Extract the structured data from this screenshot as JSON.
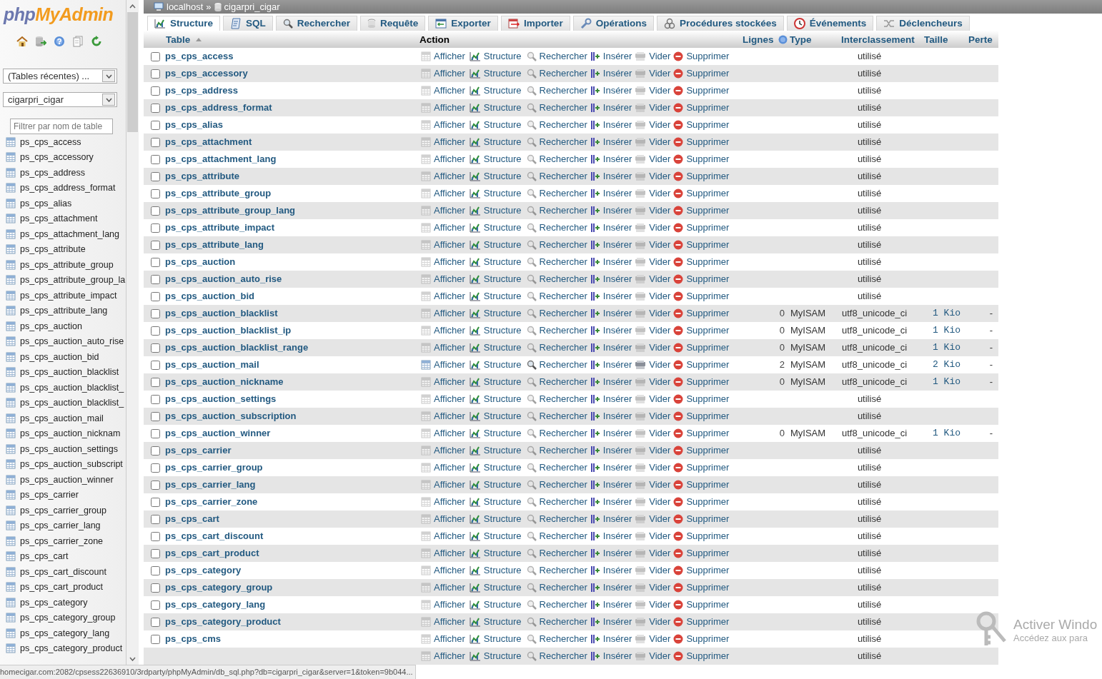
{
  "sidebar": {
    "logo": {
      "prefix": "php",
      "name": "MyAdmin"
    },
    "recent_select": {
      "value": "(Tables récentes) ..."
    },
    "database_select": {
      "value": "cigarpri_cigar"
    },
    "filter": {
      "placeholder": "Filtrer par nom de table"
    },
    "tables": [
      "ps_cps_access",
      "ps_cps_accessory",
      "ps_cps_address",
      "ps_cps_address_format",
      "ps_cps_alias",
      "ps_cps_attachment",
      "ps_cps_attachment_lang",
      "ps_cps_attribute",
      "ps_cps_attribute_group",
      "ps_cps_attribute_group_la",
      "ps_cps_attribute_impact",
      "ps_cps_attribute_lang",
      "ps_cps_auction",
      "ps_cps_auction_auto_rise",
      "ps_cps_auction_bid",
      "ps_cps_auction_blacklist",
      "ps_cps_auction_blacklist_",
      "ps_cps_auction_blacklist_",
      "ps_cps_auction_mail",
      "ps_cps_auction_nicknam",
      "ps_cps_auction_settings",
      "ps_cps_auction_subscript",
      "ps_cps_auction_winner",
      "ps_cps_carrier",
      "ps_cps_carrier_group",
      "ps_cps_carrier_lang",
      "ps_cps_carrier_zone",
      "ps_cps_cart",
      "ps_cps_cart_discount",
      "ps_cps_cart_product",
      "ps_cps_category",
      "ps_cps_category_group",
      "ps_cps_category_lang",
      "ps_cps_category_product"
    ]
  },
  "breadcrumb": {
    "server": "localhost",
    "separator": "»",
    "database": "cigarpri_cigar"
  },
  "tabs": [
    {
      "label": "Structure",
      "selected": true
    },
    {
      "label": "SQL",
      "selected": false
    },
    {
      "label": "Rechercher",
      "selected": false
    },
    {
      "label": "Requête",
      "selected": false
    },
    {
      "label": "Exporter",
      "selected": false
    },
    {
      "label": "Importer",
      "selected": false
    },
    {
      "label": "Opérations",
      "selected": false
    },
    {
      "label": "Procédures stockées",
      "selected": false
    },
    {
      "label": "Événements",
      "selected": false
    },
    {
      "label": "Déclencheurs",
      "selected": false
    }
  ],
  "table": {
    "columns": [
      "Table",
      "Action",
      "Lignes",
      "Type",
      "Interclassement",
      "Taille",
      "Perte"
    ],
    "rows": [
      {
        "name": "ps_cps_access",
        "checked": false,
        "empty": true,
        "kind": "in_use",
        "actions": [
          "Afficher",
          "Structure",
          "Rechercher",
          "Insérer",
          "Vider",
          "Supprimer"
        ],
        "status": "utilisé"
      },
      {
        "name": "ps_cps_accessory",
        "checked": false,
        "empty": true,
        "kind": "in_use",
        "actions": [
          "Afficher",
          "Structure",
          "Rechercher",
          "Insérer",
          "Vider",
          "Supprimer"
        ],
        "status": "utilisé"
      },
      {
        "name": "ps_cps_address",
        "checked": false,
        "empty": true,
        "kind": "in_use",
        "actions": [
          "Afficher",
          "Structure",
          "Rechercher",
          "Insérer",
          "Vider",
          "Supprimer"
        ],
        "status": "utilisé"
      },
      {
        "name": "ps_cps_address_format",
        "checked": false,
        "empty": true,
        "kind": "in_use",
        "actions": [
          "Afficher",
          "Structure",
          "Rechercher",
          "Insérer",
          "Vider",
          "Supprimer"
        ],
        "status": "utilisé"
      },
      {
        "name": "ps_cps_alias",
        "checked": false,
        "empty": true,
        "kind": "in_use",
        "actions": [
          "Afficher",
          "Structure",
          "Rechercher",
          "Insérer",
          "Vider",
          "Supprimer"
        ],
        "status": "utilisé"
      },
      {
        "name": "ps_cps_attachment",
        "checked": false,
        "empty": true,
        "kind": "in_use",
        "actions": [
          "Afficher",
          "Structure",
          "Rechercher",
          "Insérer",
          "Vider",
          "Supprimer"
        ],
        "status": "utilisé"
      },
      {
        "name": "ps_cps_attachment_lang",
        "checked": false,
        "empty": true,
        "kind": "in_use",
        "actions": [
          "Afficher",
          "Structure",
          "Rechercher",
          "Insérer",
          "Vider",
          "Supprimer"
        ],
        "status": "utilisé"
      },
      {
        "name": "ps_cps_attribute",
        "checked": false,
        "empty": true,
        "kind": "in_use",
        "actions": [
          "Afficher",
          "Structure",
          "Rechercher",
          "Insérer",
          "Vider",
          "Supprimer"
        ],
        "status": "utilisé"
      },
      {
        "name": "ps_cps_attribute_group",
        "checked": false,
        "empty": true,
        "kind": "in_use",
        "actions": [
          "Afficher",
          "Structure",
          "Rechercher",
          "Insérer",
          "Vider",
          "Supprimer"
        ],
        "status": "utilisé"
      },
      {
        "name": "ps_cps_attribute_group_lang",
        "checked": false,
        "empty": true,
        "kind": "in_use",
        "actions": [
          "Afficher",
          "Structure",
          "Rechercher",
          "Insérer",
          "Vider",
          "Supprimer"
        ],
        "status": "utilisé"
      },
      {
        "name": "ps_cps_attribute_impact",
        "checked": false,
        "empty": true,
        "kind": "in_use",
        "actions": [
          "Afficher",
          "Structure",
          "Rechercher",
          "Insérer",
          "Vider",
          "Supprimer"
        ],
        "status": "utilisé"
      },
      {
        "name": "ps_cps_attribute_lang",
        "checked": false,
        "empty": true,
        "kind": "in_use",
        "actions": [
          "Afficher",
          "Structure",
          "Rechercher",
          "Insérer",
          "Vider",
          "Supprimer"
        ],
        "status": "utilisé"
      },
      {
        "name": "ps_cps_auction",
        "checked": false,
        "empty": true,
        "kind": "in_use",
        "actions": [
          "Afficher",
          "Structure",
          "Rechercher",
          "Insérer",
          "Vider",
          "Supprimer"
        ],
        "status": "utilisé"
      },
      {
        "name": "ps_cps_auction_auto_rise",
        "checked": false,
        "empty": true,
        "kind": "in_use",
        "actions": [
          "Afficher",
          "Structure",
          "Rechercher",
          "Insérer",
          "Vider",
          "Supprimer"
        ],
        "status": "utilisé"
      },
      {
        "name": "ps_cps_auction_bid",
        "checked": false,
        "empty": true,
        "kind": "in_use",
        "actions": [
          "Afficher",
          "Structure",
          "Rechercher",
          "Insérer",
          "Vider",
          "Supprimer"
        ],
        "status": "utilisé"
      },
      {
        "name": "ps_cps_auction_blacklist",
        "checked": false,
        "empty": true,
        "kind": "table",
        "actions": [
          "Afficher",
          "Structure",
          "Rechercher",
          "Insérer",
          "Vider",
          "Supprimer"
        ],
        "rows": "0",
        "type": "MyISAM",
        "collation": "utf8_unicode_ci",
        "size": "1 Kio",
        "overhead": "-"
      },
      {
        "name": "ps_cps_auction_blacklist_ip",
        "checked": false,
        "empty": true,
        "kind": "table",
        "actions": [
          "Afficher",
          "Structure",
          "Rechercher",
          "Insérer",
          "Vider",
          "Supprimer"
        ],
        "rows": "0",
        "type": "MyISAM",
        "collation": "utf8_unicode_ci",
        "size": "1 Kio",
        "overhead": "-"
      },
      {
        "name": "ps_cps_auction_blacklist_range",
        "checked": false,
        "empty": true,
        "kind": "table",
        "actions": [
          "Afficher",
          "Structure",
          "Rechercher",
          "Insérer",
          "Vider",
          "Supprimer"
        ],
        "rows": "0",
        "type": "MyISAM",
        "collation": "utf8_unicode_ci",
        "size": "1 Kio",
        "overhead": "-"
      },
      {
        "name": "ps_cps_auction_mail",
        "checked": false,
        "empty": false,
        "kind": "table",
        "actions": [
          "Afficher",
          "Structure",
          "Rechercher",
          "Insérer",
          "Vider",
          "Supprimer"
        ],
        "rows": "2",
        "type": "MyISAM",
        "collation": "utf8_unicode_ci",
        "size": "2 Kio",
        "overhead": "-"
      },
      {
        "name": "ps_cps_auction_nickname",
        "checked": false,
        "empty": true,
        "kind": "table",
        "actions": [
          "Afficher",
          "Structure",
          "Rechercher",
          "Insérer",
          "Vider",
          "Supprimer"
        ],
        "rows": "0",
        "type": "MyISAM",
        "collation": "utf8_unicode_ci",
        "size": "1 Kio",
        "overhead": "-"
      },
      {
        "name": "ps_cps_auction_settings",
        "checked": false,
        "empty": true,
        "kind": "in_use",
        "actions": [
          "Afficher",
          "Structure",
          "Rechercher",
          "Insérer",
          "Vider",
          "Supprimer"
        ],
        "status": "utilisé"
      },
      {
        "name": "ps_cps_auction_subscription",
        "checked": false,
        "empty": true,
        "kind": "in_use",
        "actions": [
          "Afficher",
          "Structure",
          "Rechercher",
          "Insérer",
          "Vider",
          "Supprimer"
        ],
        "status": "utilisé"
      },
      {
        "name": "ps_cps_auction_winner",
        "checked": false,
        "empty": true,
        "kind": "table",
        "actions": [
          "Afficher",
          "Structure",
          "Rechercher",
          "Insérer",
          "Vider",
          "Supprimer"
        ],
        "rows": "0",
        "type": "MyISAM",
        "collation": "utf8_unicode_ci",
        "size": "1 Kio",
        "overhead": "-"
      },
      {
        "name": "ps_cps_carrier",
        "checked": false,
        "empty": true,
        "kind": "in_use",
        "actions": [
          "Afficher",
          "Structure",
          "Rechercher",
          "Insérer",
          "Vider",
          "Supprimer"
        ],
        "status": "utilisé"
      },
      {
        "name": "ps_cps_carrier_group",
        "checked": false,
        "empty": true,
        "kind": "in_use",
        "actions": [
          "Afficher",
          "Structure",
          "Rechercher",
          "Insérer",
          "Vider",
          "Supprimer"
        ],
        "status": "utilisé"
      },
      {
        "name": "ps_cps_carrier_lang",
        "checked": false,
        "empty": true,
        "kind": "in_use",
        "actions": [
          "Afficher",
          "Structure",
          "Rechercher",
          "Insérer",
          "Vider",
          "Supprimer"
        ],
        "status": "utilisé"
      },
      {
        "name": "ps_cps_carrier_zone",
        "checked": false,
        "empty": true,
        "kind": "in_use",
        "actions": [
          "Afficher",
          "Structure",
          "Rechercher",
          "Insérer",
          "Vider",
          "Supprimer"
        ],
        "status": "utilisé"
      },
      {
        "name": "ps_cps_cart",
        "checked": false,
        "empty": true,
        "kind": "in_use",
        "actions": [
          "Afficher",
          "Structure",
          "Rechercher",
          "Insérer",
          "Vider",
          "Supprimer"
        ],
        "status": "utilisé"
      },
      {
        "name": "ps_cps_cart_discount",
        "checked": false,
        "empty": true,
        "kind": "in_use",
        "actions": [
          "Afficher",
          "Structure",
          "Rechercher",
          "Insérer",
          "Vider",
          "Supprimer"
        ],
        "status": "utilisé"
      },
      {
        "name": "ps_cps_cart_product",
        "checked": false,
        "empty": true,
        "kind": "in_use",
        "actions": [
          "Afficher",
          "Structure",
          "Rechercher",
          "Insérer",
          "Vider",
          "Supprimer"
        ],
        "status": "utilisé"
      },
      {
        "name": "ps_cps_category",
        "checked": false,
        "empty": true,
        "kind": "in_use",
        "actions": [
          "Afficher",
          "Structure",
          "Rechercher",
          "Insérer",
          "Vider",
          "Supprimer"
        ],
        "status": "utilisé"
      },
      {
        "name": "ps_cps_category_group",
        "checked": false,
        "empty": true,
        "kind": "in_use",
        "actions": [
          "Afficher",
          "Structure",
          "Rechercher",
          "Insérer",
          "Vider",
          "Supprimer"
        ],
        "status": "utilisé"
      },
      {
        "name": "ps_cps_category_lang",
        "checked": false,
        "empty": true,
        "kind": "in_use",
        "actions": [
          "Afficher",
          "Structure",
          "Rechercher",
          "Insérer",
          "Vider",
          "Supprimer"
        ],
        "status": "utilisé"
      },
      {
        "name": "ps_cps_category_product",
        "checked": false,
        "empty": true,
        "kind": "in_use",
        "actions": [
          "Afficher",
          "Structure",
          "Rechercher",
          "Insérer",
          "Vider",
          "Supprimer"
        ],
        "status": "utilisé"
      },
      {
        "name": "ps_cps_cms",
        "checked": false,
        "empty": true,
        "kind": "in_use",
        "actions": [
          "Afficher",
          "Structure",
          "Rechercher",
          "Insérer",
          "Vider",
          "Supprimer"
        ],
        "status": "utilisé"
      },
      {
        "empty": true,
        "kind": "in_use",
        "actions": [
          "Afficher",
          "Structure",
          "Rechercher",
          "Insérer",
          "Vider",
          "Supprimer"
        ],
        "status": "utilisé"
      }
    ]
  },
  "status_bar": {
    "url": "homecigar.com:2082/cpsess22636910/3rdparty/phpMyAdmin/db_sql.php?db=cigarpri_cigar&server=1&token=9b044..."
  },
  "activation_notice": {
    "title": "Activer Windo",
    "subtitle": "Accédez aux para"
  }
}
